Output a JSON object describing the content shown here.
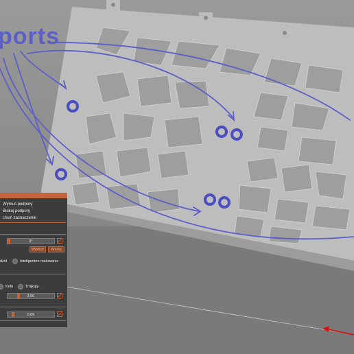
{
  "annotation": {
    "text": "ports",
    "color": "#5b5fc7"
  },
  "panel": {
    "accent": "#c8643a",
    "menu": [
      "Wymuś podpory",
      "Blokuj podpory",
      "Usuń zaznaczenie"
    ],
    "angle_value": "0°",
    "apply_label": "Wymuś",
    "cancel_label": "Anuluj",
    "select_label": "dzel",
    "smart_paint_label": "Inteligentne malowanie",
    "shape_circle_label": "Koło",
    "shape_triangle_label": "Trójkąty",
    "size_value": "2,00",
    "height_value": "0,09"
  },
  "scene": {
    "arrow_color": "#d01818"
  }
}
